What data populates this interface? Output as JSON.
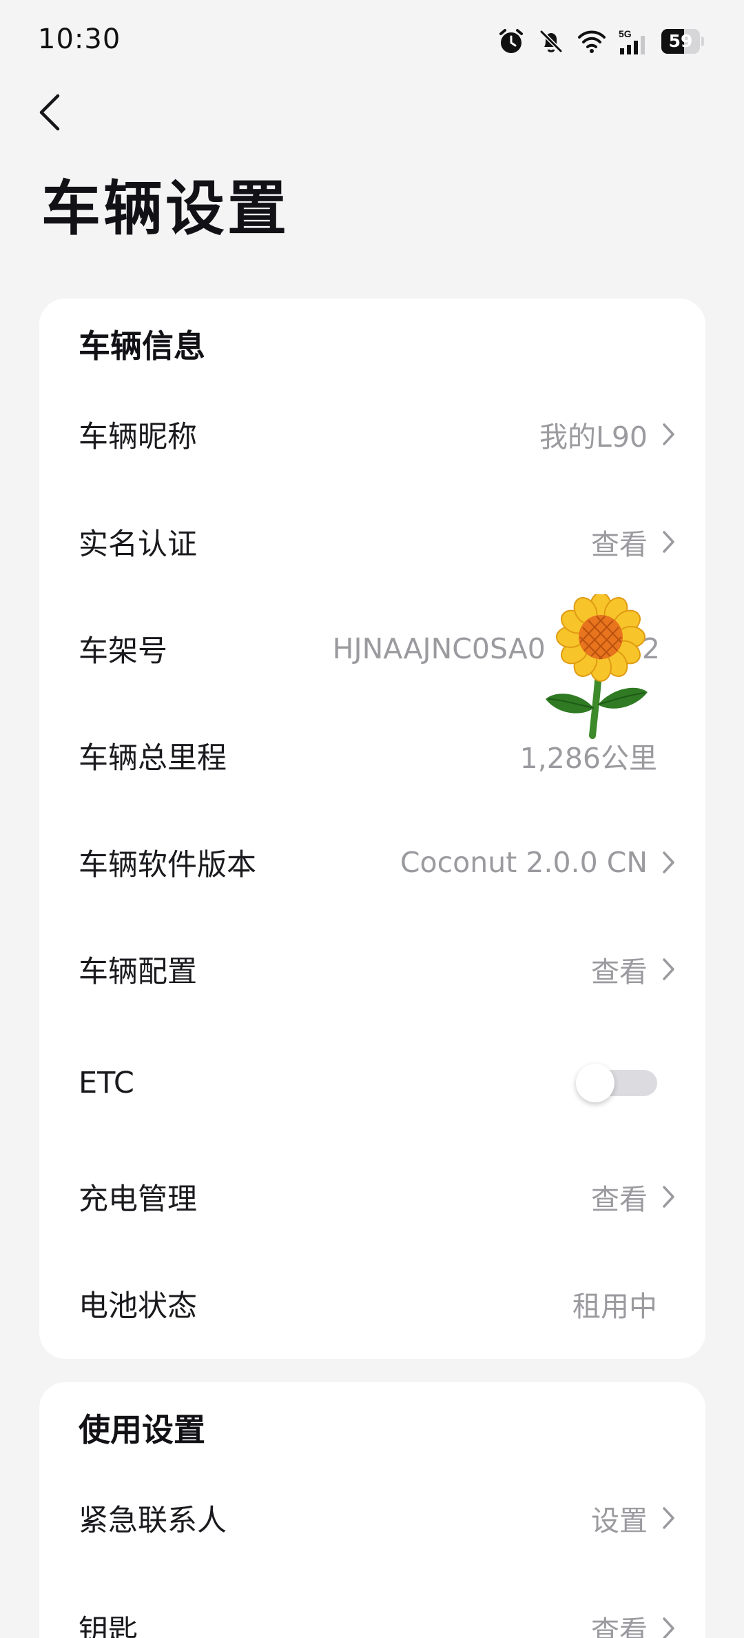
{
  "status_bar": {
    "time": "10:30",
    "network": "5G",
    "battery_level": "59",
    "battery_fraction": 0.59
  },
  "header": {
    "back_icon": "chevron-left-icon",
    "title": "车辆设置"
  },
  "vehicle_info": {
    "title": "车辆信息",
    "rows": [
      {
        "label": "车辆昵称",
        "value": "我的L90",
        "chevron": true
      },
      {
        "label": "实名认证",
        "value": "查看",
        "chevron": true
      },
      {
        "label": "车架号",
        "value": "HJNAAJNC0SA0",
        "value_tail": "2",
        "chevron": false
      },
      {
        "label": "车辆总里程",
        "value": "1,286公里",
        "chevron": false
      },
      {
        "label": "车辆软件版本",
        "value": "Coconut 2.0.0 CN",
        "chevron": true
      },
      {
        "label": "车辆配置",
        "value": "查看",
        "chevron": true
      },
      {
        "label": "ETC",
        "toggle": "off"
      },
      {
        "label": "充电管理",
        "value": "查看",
        "chevron": true
      },
      {
        "label": "电池状态",
        "value": "租用中",
        "chevron": false
      }
    ]
  },
  "usage_settings": {
    "title": "使用设置",
    "rows": [
      {
        "label": "紧急联系人",
        "value": "设置",
        "chevron": true
      },
      {
        "label": "钥匙",
        "value": "查看",
        "chevron": true
      }
    ]
  },
  "colors": {
    "background": "#f4f4f5",
    "card": "#ffffff",
    "text_primary": "#16161a",
    "text_secondary": "#9a9a9f",
    "toggle_track": "#dcdce0"
  },
  "sticker": "sunflower-icon"
}
